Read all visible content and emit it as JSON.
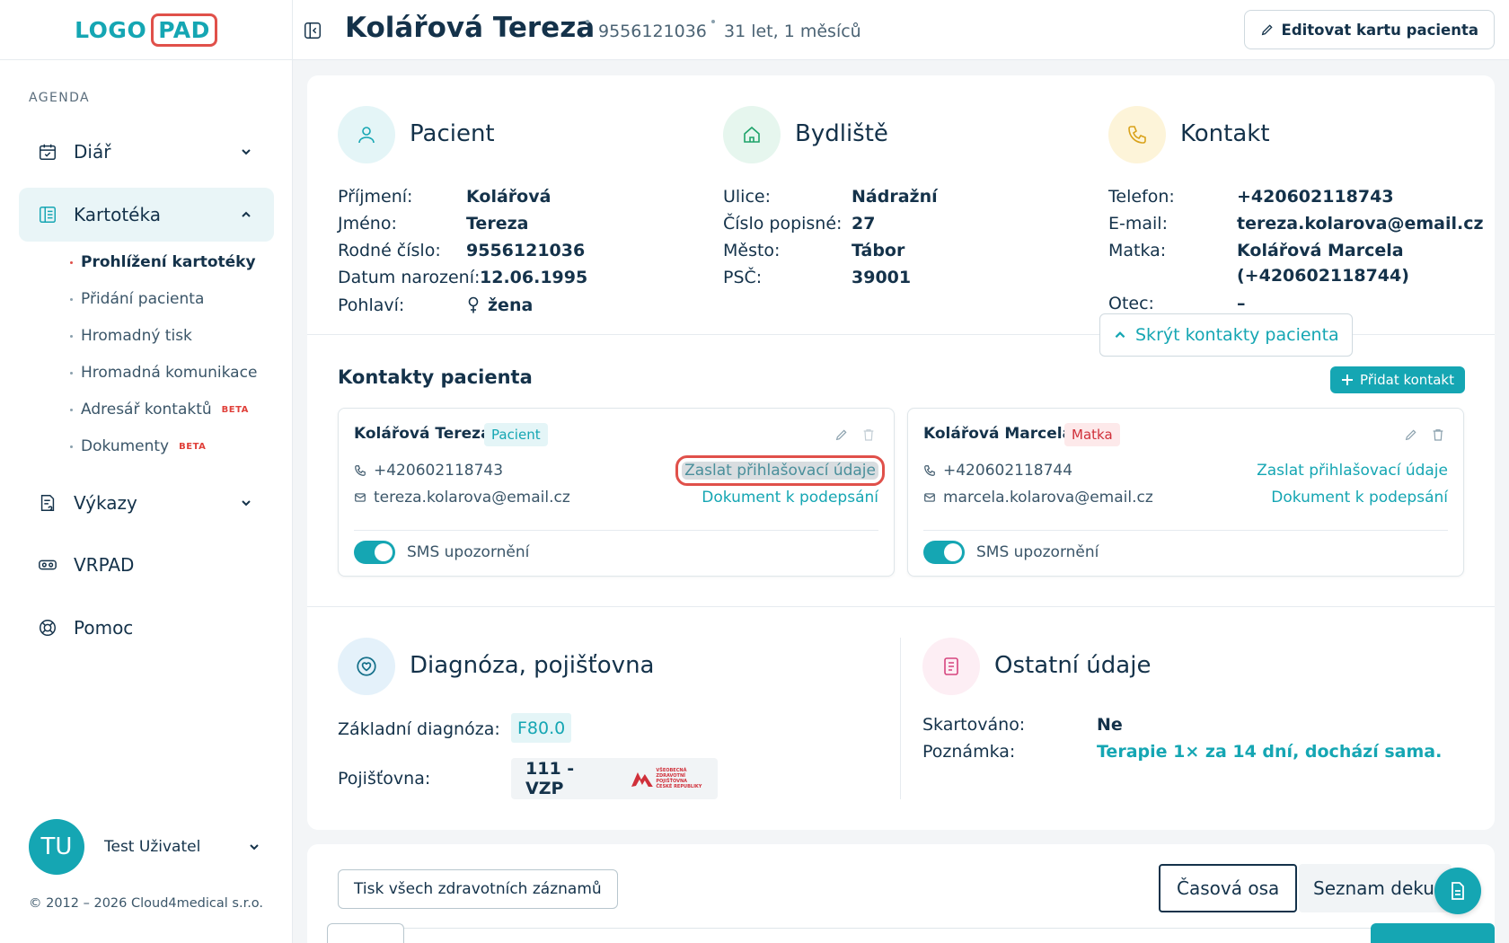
{
  "app": {
    "logo_left": "LOGO",
    "logo_right": "PAD"
  },
  "sidebar": {
    "section_label": "AGENDA",
    "items": [
      {
        "label": "Diář",
        "icon": "calendar-icon"
      },
      {
        "label": "Kartotéka",
        "icon": "card-file-icon"
      },
      {
        "label": "Výkazy",
        "icon": "report-icon"
      },
      {
        "label": "VRPAD",
        "icon": "vr-headset-icon"
      },
      {
        "label": "Pomoc",
        "icon": "lifebuoy-icon"
      }
    ],
    "subitems": [
      {
        "label": "Prohlížení kartotéky"
      },
      {
        "label": "Přidání pacienta"
      },
      {
        "label": "Hromadný tisk"
      },
      {
        "label": "Hromadná komunikace"
      },
      {
        "label": "Adresář kontaktů",
        "badge": "BETA"
      },
      {
        "label": "Dokumenty",
        "badge": "BETA"
      }
    ],
    "user": {
      "initials": "TU",
      "name": "Test Uživatel"
    },
    "copyright": "© 2012 – 2026 Cloud4medical s.r.o."
  },
  "header": {
    "patient_name": "Kolářová Tereza",
    "id_number": "9556121036",
    "age": "31 let, 1 měsíců",
    "edit_button": "Editovat kartu pacienta"
  },
  "patient": {
    "title": "Pacient",
    "fields": [
      {
        "label": "Příjmení:",
        "value": "Kolářová"
      },
      {
        "label": "Jméno:",
        "value": "Tereza"
      },
      {
        "label": "Rodné číslo:",
        "value": "9556121036"
      },
      {
        "label": "Datum narození:",
        "value": "12.06.1995"
      },
      {
        "label": "Pohlaví:",
        "value": "žena"
      }
    ]
  },
  "address": {
    "title": "Bydliště",
    "fields": [
      {
        "label": "Ulice:",
        "value": "Nádražní"
      },
      {
        "label": "Číslo popisné:",
        "value": "27"
      },
      {
        "label": "Město:",
        "value": "Tábor"
      },
      {
        "label": "PSČ:",
        "value": "39001"
      }
    ]
  },
  "contact": {
    "title": "Kontakt",
    "fields": [
      {
        "label": "Telefon:",
        "value": "+420602118743"
      },
      {
        "label": "E-mail:",
        "value": "tereza.kolarova@email.cz"
      },
      {
        "label": "Matka:",
        "value": "Kolářová Marcela",
        "value2": "(+420602118744)"
      },
      {
        "label": "Otec:",
        "value": "–"
      }
    ],
    "hide_button": "Skrýt kontakty pacienta"
  },
  "contacts": {
    "title": "Kontakty pacienta",
    "add_button": "Přidat kontakt",
    "cards": [
      {
        "name": "Kolářová Tereza",
        "badge": "Pacient",
        "phone": "+420602118743",
        "email": "tereza.kolarova@email.cz",
        "link1": "Zaslat přihlašovací údaje",
        "link2": "Dokument k podepsání",
        "toggle_label": "SMS upozornění"
      },
      {
        "name": "Kolářová Marcela",
        "badge": "Matka",
        "phone": "+420602118744",
        "email": "marcela.kolarova@email.cz",
        "link1": "Zaslat přihlašovací údaje",
        "link2": "Dokument k podepsání",
        "toggle_label": "SMS upozornění"
      }
    ]
  },
  "diagnosis": {
    "title": "Diagnóza, pojišťovna",
    "diag_label": "Základní diagnóza:",
    "diag_value": "F80.0",
    "ins_label": "Pojišťovna:",
    "ins_value": "111 - VZP",
    "ins_logo_lines": [
      "VŠEOBECNÁ",
      "ZDRAVOTNÍ POJIŠŤOVNA",
      "ČESKÉ REPUBLIKY"
    ]
  },
  "other": {
    "title": "Ostatní údaje",
    "fields": [
      {
        "label": "Skartováno:",
        "value": "Ne"
      },
      {
        "label": "Poznámka:",
        "value": "Terapie 1× za 14 dní, dochází sama."
      }
    ]
  },
  "bottom": {
    "print_button": "Tisk všech zdravotních záznamů",
    "view_timeline": "Časová osa",
    "view_list": "Seznam dekurzů"
  },
  "colors": {
    "accent": "#15a6b3",
    "highlight": "#e0504a",
    "text": "#14324a"
  }
}
